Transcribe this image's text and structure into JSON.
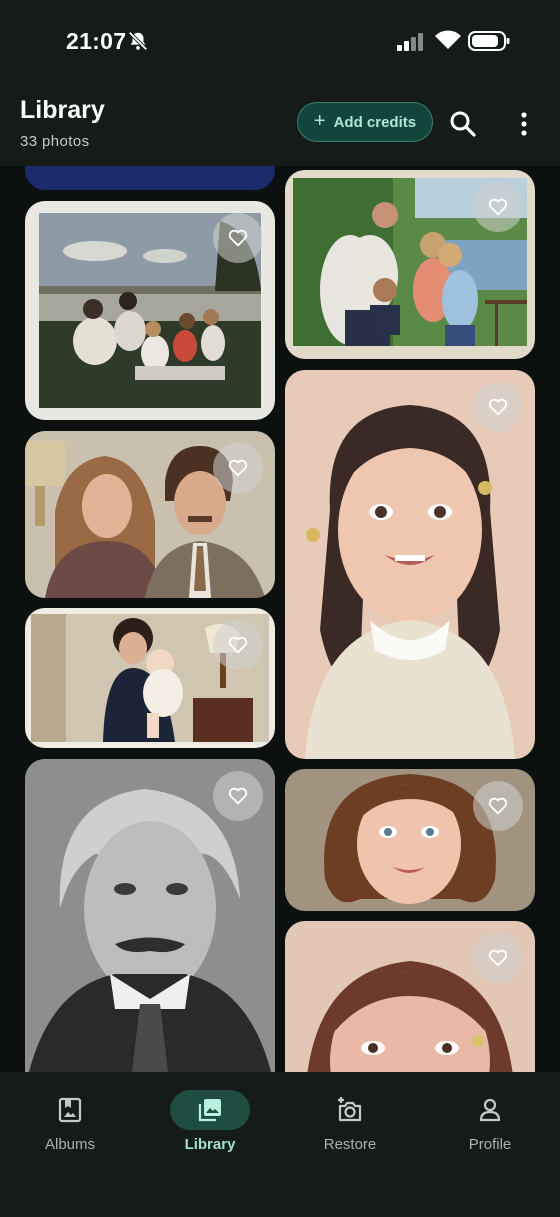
{
  "status_bar": {
    "time": "21:07"
  },
  "header": {
    "title": "Library",
    "subtitle": "33 photos",
    "add_credits_label": "Add credits"
  },
  "photos": [
    {
      "name": "Top crop (previous photo)",
      "favorite": false
    },
    {
      "name": "Family picnic",
      "favorite": false
    },
    {
      "name": "Family by lake",
      "favorite": false
    },
    {
      "name": "Couple portrait",
      "favorite": false
    },
    {
      "name": "Girl with pigtails",
      "favorite": false
    },
    {
      "name": "Mother and baby",
      "favorite": false
    },
    {
      "name": "Man with mustache",
      "favorite": false
    },
    {
      "name": "Curly girl",
      "favorite": false
    },
    {
      "name": "Girl portrait",
      "favorite": false
    }
  ],
  "nav": {
    "albums": "Albums",
    "library": "Library",
    "restore": "Restore",
    "profile": "Profile",
    "active": "library"
  },
  "colors": {
    "background": "#0c100f",
    "surface": "#151b19",
    "accent": "#a9ead8",
    "accent_container": "#1f4d42"
  }
}
